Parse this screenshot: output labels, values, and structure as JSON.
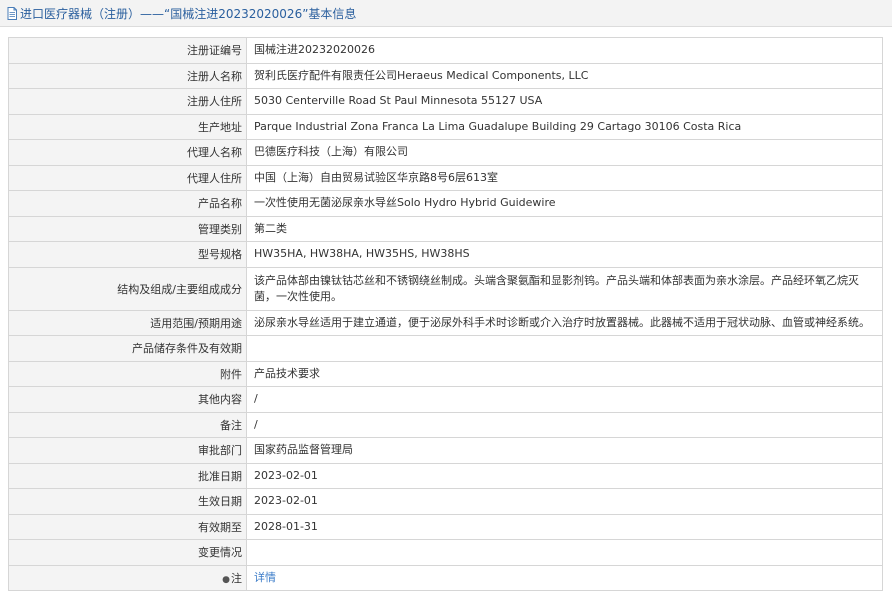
{
  "header": {
    "title": "进口医疗器械（注册）——“国械注进20232020026”基本信息",
    "icon": "document-icon"
  },
  "rows": [
    {
      "label": "注册证编号",
      "value": "国械注进20232020026"
    },
    {
      "label": "注册人名称",
      "value": "贺利氏医疗配件有限责任公司Heraeus Medical Components, LLC"
    },
    {
      "label": "注册人住所",
      "value": "5030 Centerville Road St Paul Minnesota 55127 USA"
    },
    {
      "label": "生产地址",
      "value": "Parque Industrial Zona Franca La Lima Guadalupe Building 29 Cartago 30106 Costa Rica"
    },
    {
      "label": "代理人名称",
      "value": "巴德医疗科技（上海）有限公司"
    },
    {
      "label": "代理人住所",
      "value": "中国（上海）自由贸易试验区华京路8号6层613室"
    },
    {
      "label": "产品名称",
      "value": "一次性使用无菌泌尿亲水导丝Solo Hydro Hybrid Guidewire"
    },
    {
      "label": "管理类别",
      "value": "第二类"
    },
    {
      "label": "型号规格",
      "value": "HW35HA, HW38HA, HW35HS, HW38HS"
    },
    {
      "label": "结构及组成/主要组成成分",
      "value": "该产品体部由镍钛钴芯丝和不锈钢绕丝制成。头端含聚氨酯和显影剂钨。产品头端和体部表面为亲水涂层。产品经环氧乙烷灭菌，一次性使用。"
    },
    {
      "label": "适用范围/预期用途",
      "value": "泌尿亲水导丝适用于建立通道，便于泌尿外科手术时诊断或介入治疗时放置器械。此器械不适用于冠状动脉、血管或神经系统。"
    },
    {
      "label": "产品储存条件及有效期",
      "value": ""
    },
    {
      "label": "附件",
      "value": "产品技术要求"
    },
    {
      "label": "其他内容",
      "value": "/"
    },
    {
      "label": "备注",
      "value": "/"
    },
    {
      "label": "审批部门",
      "value": "国家药品监督管理局"
    },
    {
      "label": "批准日期",
      "value": "2023-02-01"
    },
    {
      "label": "生效日期",
      "value": "2023-02-01"
    },
    {
      "label": "有效期至",
      "value": "2028-01-31"
    },
    {
      "label": "变更情况",
      "value": ""
    },
    {
      "label": "注",
      "value": "详情",
      "icon": "pin-icon"
    }
  ],
  "colors": {
    "title_text": "#2a5f9e",
    "link": "#3a7bc8",
    "label_bg": "#f4f4f4",
    "border": "#d6d6d6"
  }
}
